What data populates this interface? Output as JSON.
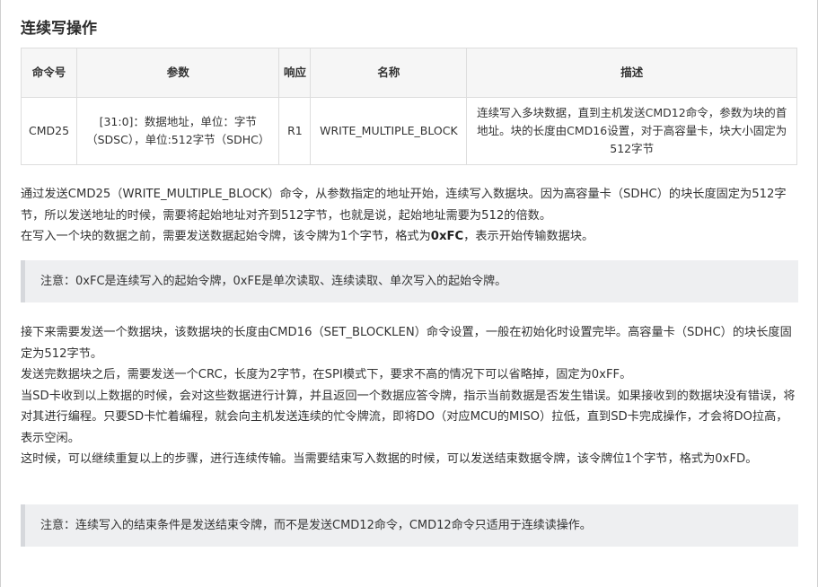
{
  "heading": "连续写操作",
  "table": {
    "headers": [
      "命令号",
      "参数",
      "响应",
      "名称",
      "描述"
    ],
    "row": {
      "cmd": "CMD25",
      "param": "[31:0]：数据地址，单位：字节（SDSC），单位:512字节（SDHC）",
      "response": "R1",
      "name": "WRITE_MULTIPLE_BLOCK",
      "description": "连续写入多块数据，直到主机发送CMD12命令，参数为块的首地址。块的长度由CMD16设置，对于高容量卡，块大小固定为512字节"
    }
  },
  "para1": {
    "line1": "通过发送CMD25（WRITE_MULTIPLE_BLOCK）命令，从参数指定的地址开始，连续写入数据块。因为高容量卡（SDHC）的块长度固定为512字节，所以发送地址的时候，需要将起始地址对齐到512字节，也就是说，起始地址需要为512的倍数。",
    "line2_prefix": "在写入一个块的数据之前，需要发送数据起始令牌，该令牌为1个字节，格式为",
    "line2_code": "0xFC",
    "line2_suffix": "，表示开始传输数据块。"
  },
  "note1": "注意：0xFC是连续写入的起始令牌，0xFE是单次读取、连续读取、单次写入的起始令牌。",
  "para2": {
    "s1": "接下来需要发送一个数据块，该数据块的长度由CMD16（SET_BLOCKLEN）命令设置，一般在初始化时设置完毕。高容量卡（SDHC）的块长度固定为512字节。",
    "s2": "发送完数据块之后，需要发送一个CRC，长度为2字节，在SPI模式下，要求不高的情况下可以省略掉，固定为0xFF。",
    "s3": "当SD卡收到以上数据的时候，会对这些数据进行计算，并且返回一个数据应答令牌，指示当前数据是否发生错误。如果接收到的数据块没有错误，将对其进行编程。只要SD卡忙着编程，就会向主机发送连续的忙令牌流，即将DO（对应MCU的MISO）拉低，直到SD卡完成操作，才会将DO拉高，表示空闲。",
    "s4": "这时候，可以继续重复以上的步骤，进行连续传输。当需要结束写入数据的时候，可以发送结束数据令牌，该令牌位1个字节，格式为0xFD。"
  },
  "note2": "注意：连续写入的结束条件是发送结束令牌，而不是发送CMD12命令，CMD12命令只适用于连续读操作。"
}
